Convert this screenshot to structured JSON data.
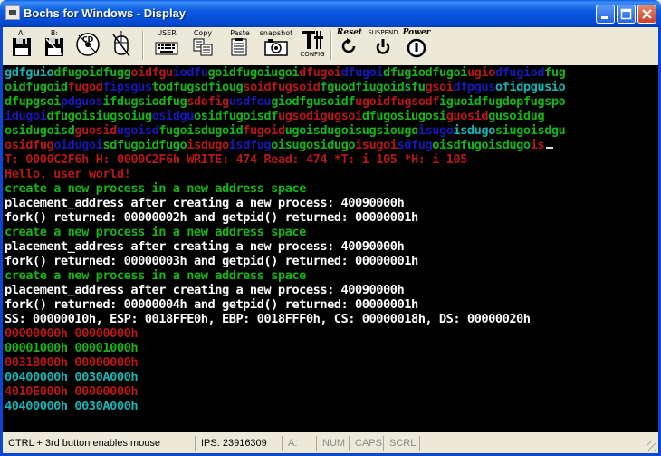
{
  "window": {
    "title": "Bochs for Windows - Display"
  },
  "toolbar": {
    "items": [
      {
        "name": "floppy-a-button",
        "label": "A:",
        "icon": "floppy-disk-icon"
      },
      {
        "name": "floppy-b-button",
        "label": "B:",
        "icon": "floppy-disk-icon"
      },
      {
        "name": "cdrom-button",
        "label": "CD",
        "icon": "cdrom-icon"
      },
      {
        "name": "mouse-toggle-button",
        "label": "",
        "icon": "mouse-icon"
      },
      {
        "name": "user-button",
        "label": "USER",
        "icon": "keyboard-icon"
      },
      {
        "name": "copy-button",
        "label": "Copy",
        "icon": "copy-icon"
      },
      {
        "name": "paste-button",
        "label": "Paste",
        "icon": "paste-icon"
      },
      {
        "name": "snapshot-button",
        "label": "snapshot",
        "icon": "camera-icon"
      },
      {
        "name": "config-button",
        "label": "CONFIG",
        "icon": "config-icon"
      },
      {
        "name": "reset-button",
        "label": "Reset",
        "icon": "reset-icon"
      },
      {
        "name": "suspend-button",
        "label": "SUSPEND",
        "icon": "suspend-icon"
      },
      {
        "name": "power-button",
        "label": "Power",
        "icon": "power-icon"
      }
    ]
  },
  "display": {
    "lines": [
      {
        "segments": [
          {
            "t": "gdfguio",
            "c": "#18b2b2"
          },
          {
            "t": "dfugoidfugg",
            "c": "#18b218"
          },
          {
            "t": "oidfgu",
            "c": "#b21818"
          },
          {
            "t": "iodfu",
            "c": "#1818b2"
          },
          {
            "t": "goidfugoiugoi",
            "c": "#18b218"
          },
          {
            "t": "dfugoi",
            "c": "#b21818"
          },
          {
            "t": "dfugoi",
            "c": "#1818b2"
          },
          {
            "t": "dfugiodfugoi",
            "c": "#18b218"
          },
          {
            "t": "ugio",
            "c": "#b21818"
          },
          {
            "t": "dfugiod",
            "c": "#1818b2"
          },
          {
            "t": "fug",
            "c": "#18b218"
          }
        ]
      },
      {
        "segments": [
          {
            "t": "oidfugoid",
            "c": "#18b218"
          },
          {
            "t": "fugod",
            "c": "#b21818"
          },
          {
            "t": "fipsgus",
            "c": "#1818b2"
          },
          {
            "t": "todfugsdfioug",
            "c": "#18b218"
          },
          {
            "t": "soidfugsoid",
            "c": "#b21818"
          },
          {
            "t": "fguodfiugoidsfu",
            "c": "#18b218"
          },
          {
            "t": "gsoi",
            "c": "#b21818"
          },
          {
            "t": "dfpgus",
            "c": "#1818b2"
          },
          {
            "t": "ofidpgusio",
            "c": "#18b2b2"
          }
        ]
      },
      {
        "segments": [
          {
            "t": "dfupgsoi",
            "c": "#18b218"
          },
          {
            "t": "pdguos",
            "c": "#1818b2"
          },
          {
            "t": "ifdugsiodfug",
            "c": "#18b218"
          },
          {
            "t": "sdofig",
            "c": "#b21818"
          },
          {
            "t": "usdfou",
            "c": "#1818b2"
          },
          {
            "t": "giodfgusoidf",
            "c": "#18b218"
          },
          {
            "t": "ugoidfugsodf",
            "c": "#b21818"
          },
          {
            "t": "iguoidfugdopfugspo",
            "c": "#18b218"
          }
        ]
      },
      {
        "segments": [
          {
            "t": "idugoi",
            "c": "#1818b2"
          },
          {
            "t": "dfugoisiugsoiug",
            "c": "#18b218"
          },
          {
            "t": "osidgu",
            "c": "#1818b2"
          },
          {
            "t": "osidfugoisdf",
            "c": "#18b218"
          },
          {
            "t": "ugsodigugsoi",
            "c": "#b21818"
          },
          {
            "t": "dfugosiugosi",
            "c": "#18b218"
          },
          {
            "t": "guosid",
            "c": "#b21818"
          },
          {
            "t": "gusoidug",
            "c": "#18b218"
          }
        ]
      },
      {
        "segments": [
          {
            "t": "osidugoisd",
            "c": "#18b218"
          },
          {
            "t": "guosid",
            "c": "#b21818"
          },
          {
            "t": "ugoisd",
            "c": "#1818b2"
          },
          {
            "t": "fugoisdugoid",
            "c": "#18b218"
          },
          {
            "t": "fugoid",
            "c": "#b21818"
          },
          {
            "t": "ugoisdugoisugsiougo",
            "c": "#18b218"
          },
          {
            "t": "isugo",
            "c": "#1818b2"
          },
          {
            "t": "isdugo",
            "c": "#18b2b2"
          },
          {
            "t": "siugoisdgu",
            "c": "#18b218"
          }
        ]
      },
      {
        "segments": [
          {
            "t": "osidfug",
            "c": "#b21818"
          },
          {
            "t": "oidugoi",
            "c": "#1818b2"
          },
          {
            "t": "sdfugoidfugo",
            "c": "#18b218"
          },
          {
            "t": "isdugo",
            "c": "#b21818"
          },
          {
            "t": "isdfug",
            "c": "#1818b2"
          },
          {
            "t": "oisugosidugo",
            "c": "#18b218"
          },
          {
            "t": "isugoi",
            "c": "#b21818"
          },
          {
            "t": "sdfug",
            "c": "#1818b2"
          },
          {
            "t": "oisdfugoisdugo",
            "c": "#18b218"
          },
          {
            "t": "is",
            "c": "#b21818"
          }
        ],
        "cursor": true
      },
      {
        "segments": [
          {
            "t": "T: 0000C2F6h H: 0000C2F6h WRITE: 474 Read: 474 *T: i 105 *H: i 105",
            "c": "#b21818"
          }
        ]
      },
      {
        "segments": [
          {
            "t": "Hello, user world!",
            "c": "#b21818"
          }
        ]
      },
      {
        "segments": [
          {
            "t": "create a new process in a new address space",
            "c": "#18b218"
          }
        ]
      },
      {
        "segments": [
          {
            "t": "placement_address after creating a new process: 40090000h",
            "c": "#ffffff"
          }
        ]
      },
      {
        "segments": [
          {
            "t": "fork() returned: 00000002h and getpid() returned: 00000001h",
            "c": "#ffffff"
          }
        ]
      },
      {
        "segments": [
          {
            "t": "create a new process in a new address space",
            "c": "#18b218"
          }
        ]
      },
      {
        "segments": [
          {
            "t": "placement_address after creating a new process: 40090000h",
            "c": "#ffffff"
          }
        ]
      },
      {
        "segments": [
          {
            "t": "fork() returned: 00000003h and getpid() returned: 00000001h",
            "c": "#ffffff"
          }
        ]
      },
      {
        "segments": [
          {
            "t": "create a new process in a new address space",
            "c": "#18b218"
          }
        ]
      },
      {
        "segments": [
          {
            "t": "placement_address after creating a new process: 40090000h",
            "c": "#ffffff"
          }
        ]
      },
      {
        "segments": [
          {
            "t": "fork() returned: 00000004h and getpid() returned: 00000001h",
            "c": "#ffffff"
          }
        ]
      },
      {
        "segments": [
          {
            "t": "SS: 00000010h, ESP: 0018FFE0h, EBP: 0018FFF0h, CS: 00000018h, DS: 00000020h",
            "c": "#ffffff"
          }
        ]
      },
      {
        "segments": [
          {
            "t": "00000000h 00000000h",
            "c": "#b21818"
          }
        ]
      },
      {
        "segments": [
          {
            "t": "00001000h 00001000h",
            "c": "#18b218"
          }
        ]
      },
      {
        "segments": [
          {
            "t": "0031B000h 00000000h",
            "c": "#b21818"
          }
        ]
      },
      {
        "segments": [
          {
            "t": "00400000h 0030A000h",
            "c": "#18b2b2"
          }
        ]
      },
      {
        "segments": [
          {
            "t": "4010E000h 00000000h",
            "c": "#b21818"
          }
        ]
      },
      {
        "segments": [
          {
            "t": "40400000h 0030A000h",
            "c": "#18b2b2"
          }
        ]
      }
    ]
  },
  "statusbar": {
    "hint": "CTRL + 3rd button enables mouse",
    "ips": "IPS: 23916309",
    "drive": "A:",
    "num": "NUM",
    "caps": "CAPS",
    "scrl": "SCRL"
  }
}
